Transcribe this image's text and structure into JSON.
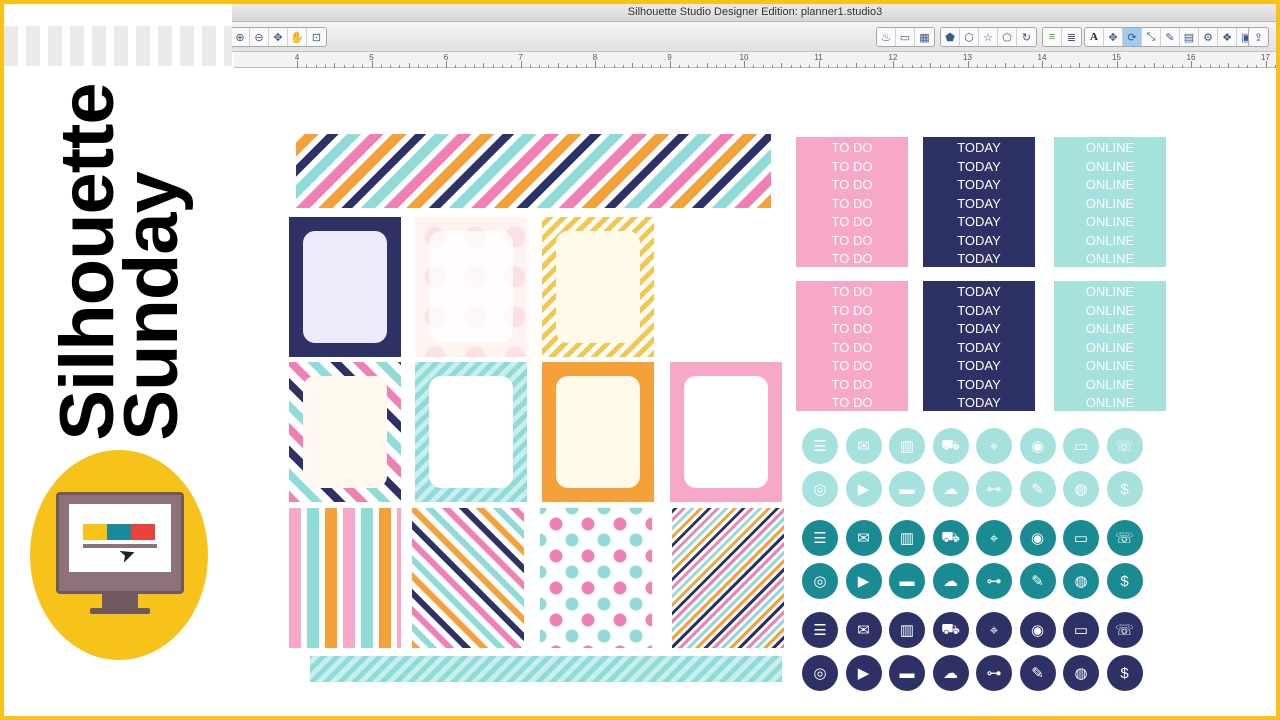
{
  "window": {
    "title": "Silhouette Studio Designer Edition: planner1.studio3"
  },
  "brand": {
    "line1": "Silhouette",
    "line2": "Sunday"
  },
  "toolbar": {
    "left_tools": [
      "zoom-in-icon",
      "zoom-out-icon",
      "pan-icon",
      "hand-icon",
      "fit-icon"
    ],
    "right_tools": [
      "lamp-icon",
      "window-icon",
      "grid-icon",
      "pentagon-icon",
      "hexagon-icon",
      "star-icon",
      "polygon-icon",
      "rotate-icon",
      "line-green-icon",
      "line-gray-icon",
      "text-icon",
      "move-icon",
      "replicate-icon",
      "scale-icon",
      "pen-icon",
      "library-icon",
      "fill-icon",
      "settings-icon",
      "trace-icon",
      "send-icon",
      "page-icon"
    ],
    "text_glyph": "A"
  },
  "ruler": {
    "labels": [
      "4",
      "5",
      "6",
      "7",
      "8",
      "9",
      "10",
      "11",
      "12",
      "13",
      "14",
      "15",
      "16",
      "17"
    ]
  },
  "labels": {
    "todo": "TO DO",
    "today": "TODAY",
    "online": "ONLINE"
  },
  "colors": {
    "pink": "#f7a8c9",
    "navy": "#2e3166",
    "aqua": "#9fe0dc",
    "teal": "#1a8a93",
    "light_aqua": "#a5e1dd",
    "orange": "#f5a13a",
    "yellow": "#f4c64a",
    "accent": "#f7c21a"
  },
  "icons": {
    "rows": [
      [
        "chat-icon",
        "mail-icon",
        "trash-icon",
        "cart-icon",
        "location-pin-icon",
        "camera-icon",
        "monitor-icon",
        "phone-icon"
      ],
      [
        "scale-icon",
        "youtube-icon",
        "credit-card-icon",
        "cloud-upload-icon",
        "dumbbell-icon",
        "pencil-icon",
        "money-roll-icon",
        "piggy-bank-icon"
      ]
    ]
  }
}
